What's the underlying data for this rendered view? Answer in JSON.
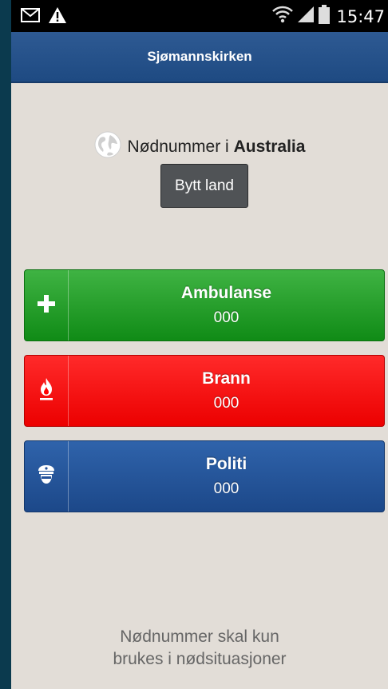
{
  "status_bar": {
    "time": "15:47",
    "left_icons": [
      "gmail-icon",
      "warning-icon"
    ],
    "right_icons": [
      "wifi-icon",
      "signal-icon",
      "battery-icon"
    ]
  },
  "app_bar": {
    "title": "Sjømannskirken"
  },
  "country": {
    "prefix": "Nødnummer i",
    "name": "Australia",
    "icon": "globe-icon",
    "change_button": "Bytt land"
  },
  "emergency": [
    {
      "label": "Ambulanse",
      "number": "000",
      "icon": "plus-icon",
      "color": "#1a9a1f"
    },
    {
      "label": "Brann",
      "number": "000",
      "icon": "fire-icon",
      "color": "#ff0000"
    },
    {
      "label": "Politi",
      "number": "000",
      "icon": "police-icon",
      "color": "#24529a"
    }
  ],
  "footer": {
    "line1": "Nødnummer skal kun",
    "line2": "brukes i nødsituasjoner"
  }
}
